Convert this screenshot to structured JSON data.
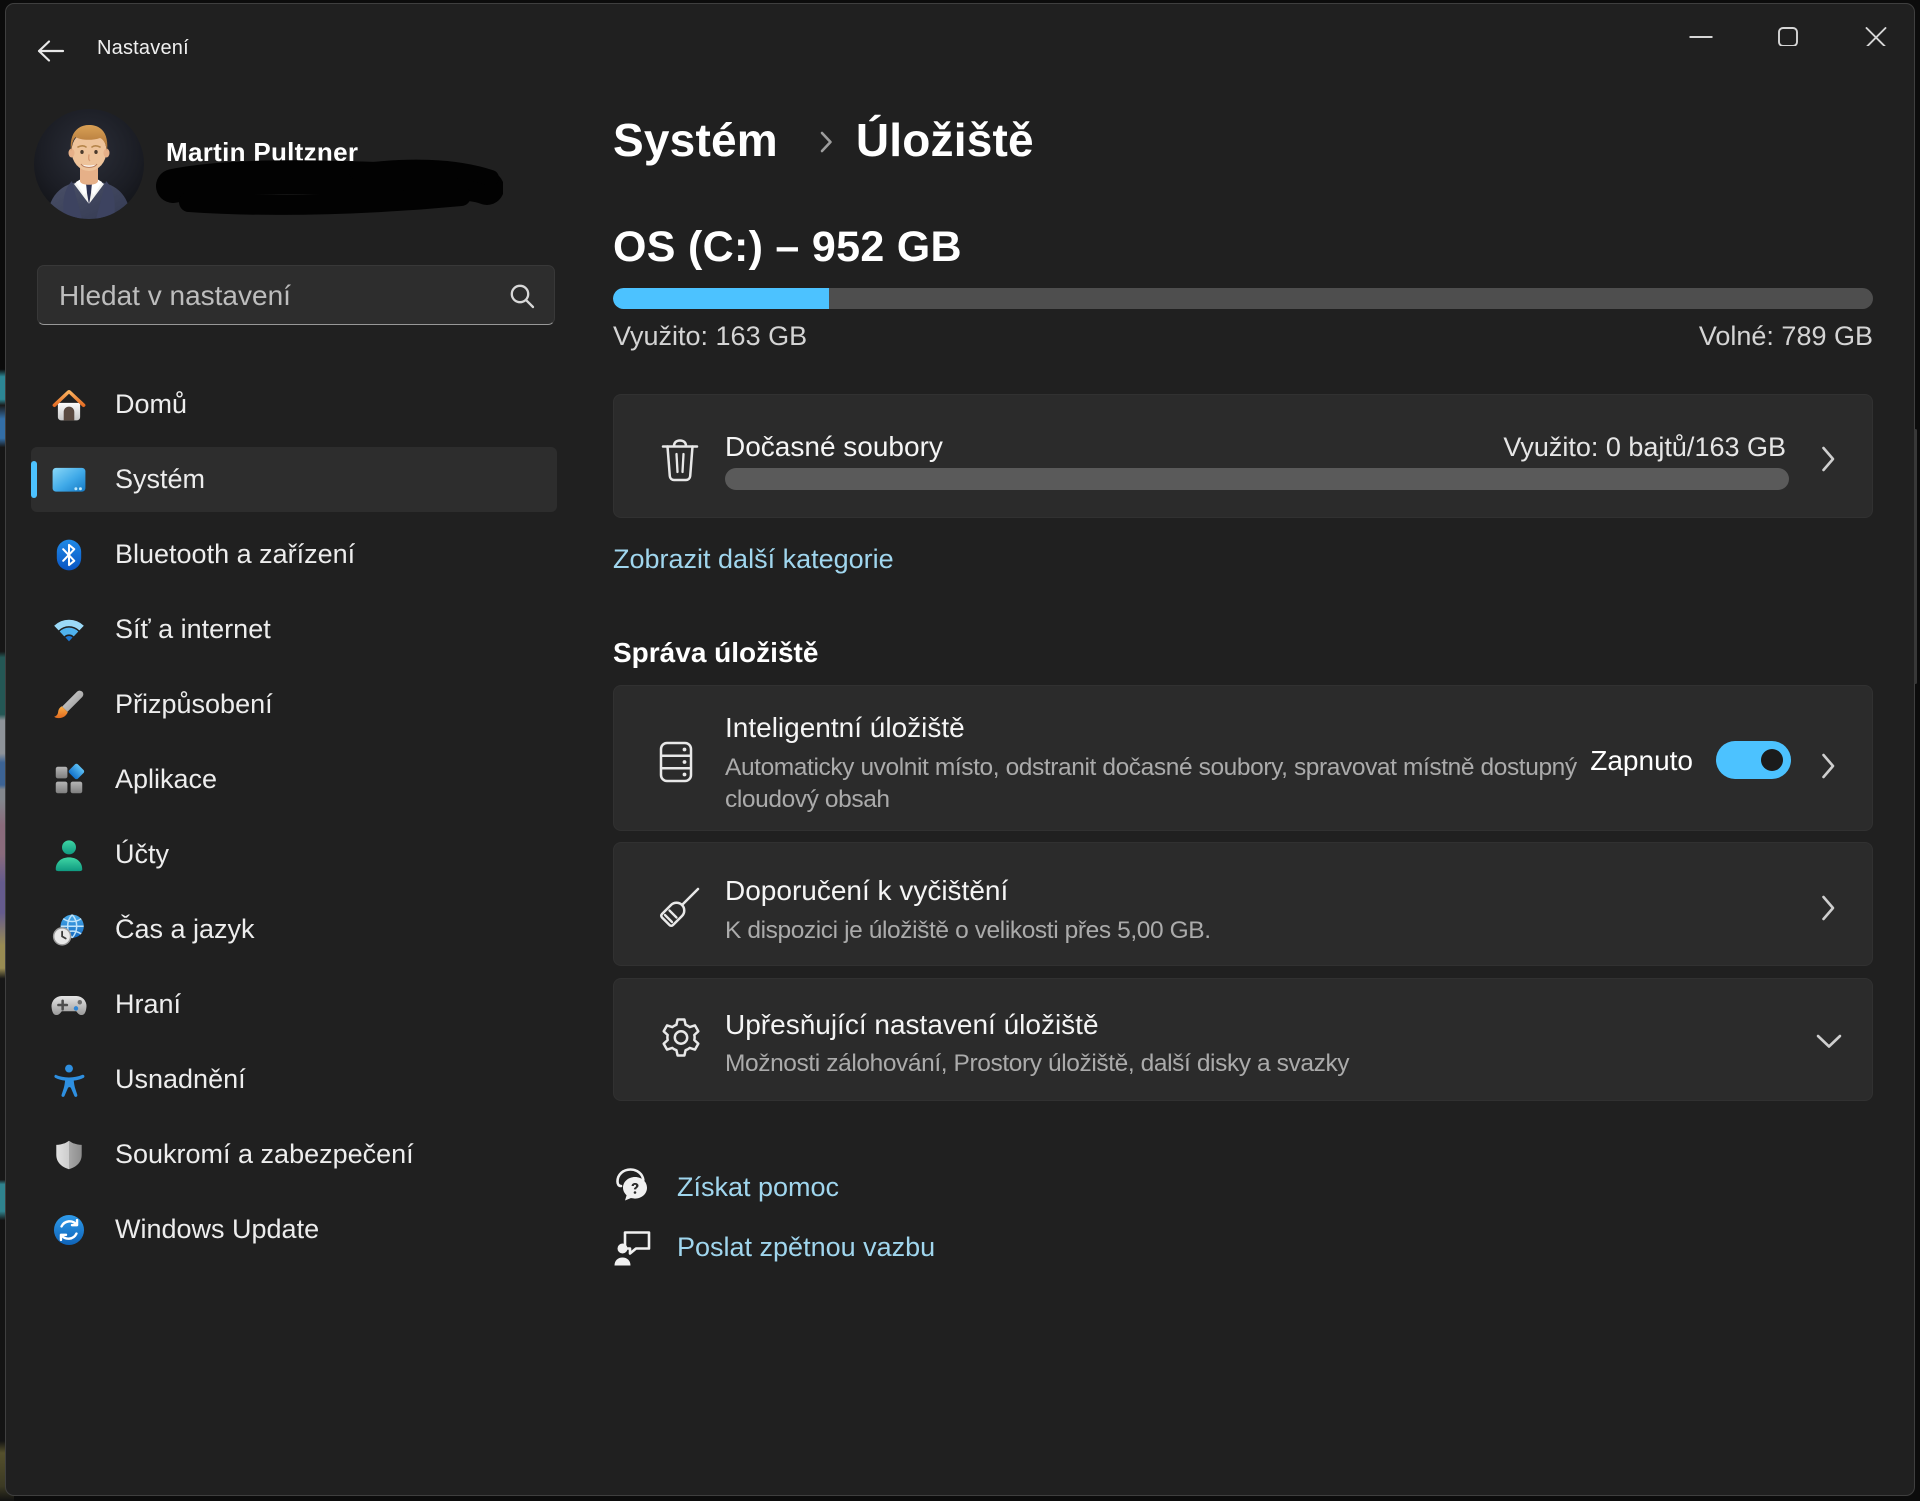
{
  "window": {
    "app_title": "Nastavení",
    "caption": {
      "minimize": "minimize",
      "maximize": "maximize",
      "close": "close"
    }
  },
  "profile": {
    "name": "Martin Pultzner",
    "email_redacted": true
  },
  "search": {
    "placeholder": "Hledat v nastavení"
  },
  "sidebar": {
    "selected": "Systém",
    "items": [
      {
        "label": "Domů",
        "icon": "home-icon"
      },
      {
        "label": "Systém",
        "icon": "system-icon"
      },
      {
        "label": "Bluetooth a zařízení",
        "icon": "bluetooth-icon"
      },
      {
        "label": "Síť a internet",
        "icon": "network-icon"
      },
      {
        "label": "Přizpůsobení",
        "icon": "personalization-icon"
      },
      {
        "label": "Aplikace",
        "icon": "apps-icon"
      },
      {
        "label": "Účty",
        "icon": "accounts-icon"
      },
      {
        "label": "Čas a jazyk",
        "icon": "time-language-icon"
      },
      {
        "label": "Hraní",
        "icon": "gaming-icon"
      },
      {
        "label": "Usnadnění",
        "icon": "accessibility-icon"
      },
      {
        "label": "Soukromí a zabezpečení",
        "icon": "privacy-icon"
      },
      {
        "label": "Windows Update",
        "icon": "windows-update-icon"
      }
    ]
  },
  "main": {
    "breadcrumb": {
      "parent": "Systém",
      "separator": "›",
      "current": "Úložiště"
    },
    "drive": {
      "title": "OS (C:) – 952 GB",
      "used_label": "Využito: 163 GB",
      "free_label": "Volné: 789 GB",
      "used_percent": "17.12%"
    },
    "temp_files": {
      "title": "Dočasné soubory",
      "usage": "Využito: 0 bajtů/163 GB",
      "used_percent": "0%"
    },
    "show_more_link": "Zobrazit další kategorie",
    "section_title": "Správa úložiště",
    "cards": [
      {
        "title": "Inteligentní úložiště",
        "description": "Automaticky uvolnit místo, odstranit dočasné soubory, spravovat místně dostupný cloudový obsah",
        "toggle_label": "Zapnuto",
        "toggle_on": true
      },
      {
        "title": "Doporučení k vyčištění",
        "description": "K dispozici je úložiště o velikosti přes 5,00 GB."
      },
      {
        "title": "Upřesňující nastavení úložiště",
        "description": "Možnosti zálohování, Prostory úložiště, další disky a svazky"
      }
    ],
    "footer_links": [
      {
        "label": "Získat pomoc",
        "icon": "get-help-icon"
      },
      {
        "label": "Poslat zpětnou vazbu",
        "icon": "feedback-icon"
      }
    ]
  },
  "colors": {
    "accent": "#4cc2ff",
    "window_bg": "#202020",
    "card_bg": "#2b2b2b",
    "link": "#a0d6ee",
    "track": "#4e4e4e"
  }
}
